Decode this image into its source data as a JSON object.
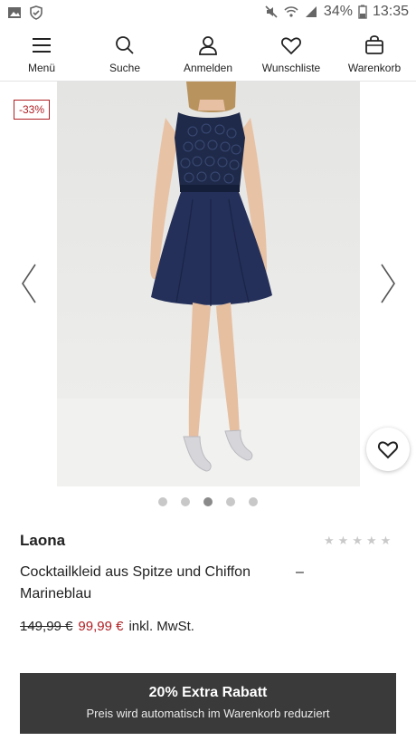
{
  "status_bar": {
    "battery_percent": "34%",
    "time": "13:35",
    "icons": [
      "image-icon",
      "shield-icon",
      "mute-icon",
      "wifi-icon",
      "signal-icon",
      "battery-icon"
    ]
  },
  "nav": {
    "items": [
      {
        "label": "Menü",
        "icon": "hamburger-icon"
      },
      {
        "label": "Suche",
        "icon": "search-icon"
      },
      {
        "label": "Anmelden",
        "icon": "user-icon"
      },
      {
        "label": "Wunschliste",
        "icon": "heart-icon"
      },
      {
        "label": "Warenkorb",
        "icon": "bag-icon"
      }
    ]
  },
  "gallery": {
    "discount_badge": "-33%",
    "image_count": 5,
    "active_index": 2
  },
  "product": {
    "brand": "Laona",
    "title": "Cocktailkleid aus Spitze und Chiffon Marineblau",
    "title_dash": "–",
    "rating_stars": 0,
    "max_stars": 5,
    "old_price": "149,99 €",
    "new_price": "99,99 €",
    "tax_note": "inkl. MwSt."
  },
  "promo": {
    "title": "20% Extra Rabatt",
    "subtitle": "Preis wird automatisch im Warenkorb reduziert"
  },
  "colors": {
    "accent_red": "#b01e23",
    "promo_bg": "#3a3a3a",
    "dress_navy": "#1f2a4a"
  }
}
